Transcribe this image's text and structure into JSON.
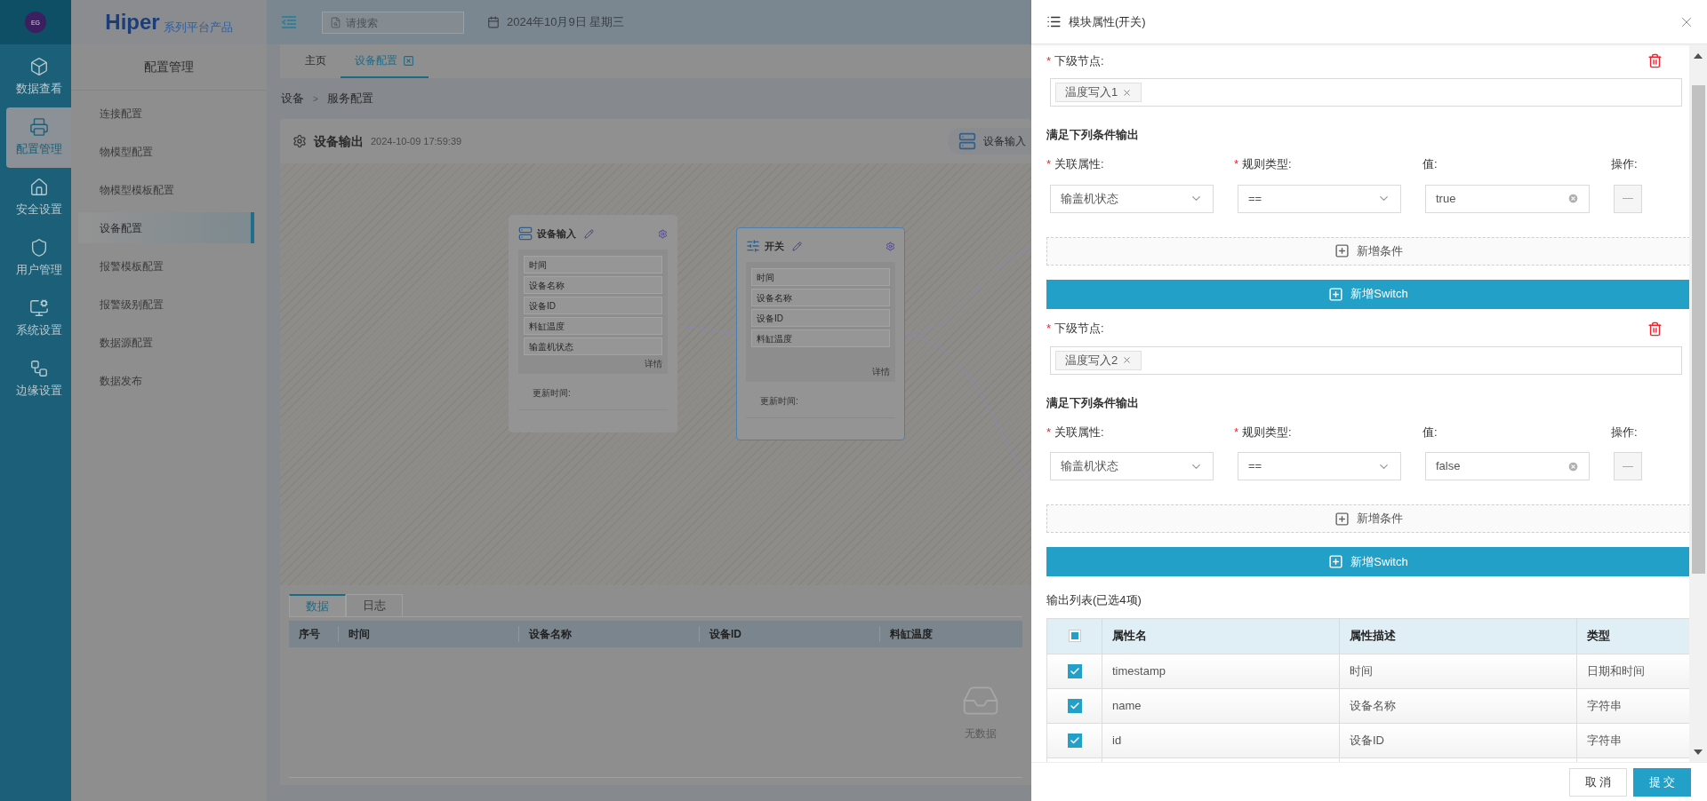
{
  "rail": {
    "logo_text": "EG",
    "items": [
      {
        "label": "数据查看",
        "kind": "cube",
        "selected": false
      },
      {
        "label": "配置管理",
        "kind": "printer",
        "selected": true
      },
      {
        "label": "安全设置",
        "kind": "house",
        "selected": false
      },
      {
        "label": "用户管理",
        "kind": "shield",
        "selected": false
      },
      {
        "label": "系统设置",
        "kind": "monitor",
        "selected": false
      },
      {
        "label": "边缘设置",
        "kind": "workflow",
        "selected": false
      }
    ]
  },
  "brand": {
    "name": "Hiper",
    "tagline": "系列平台产品"
  },
  "config_menu": {
    "title": "配置管理",
    "items": [
      {
        "label": "连接配置",
        "selected": false
      },
      {
        "label": "物模型配置",
        "selected": false
      },
      {
        "label": "物模型模板配置",
        "selected": false
      },
      {
        "label": "设备配置",
        "selected": true
      },
      {
        "label": "报警模板配置",
        "selected": false
      },
      {
        "label": "报警级别配置",
        "selected": false
      },
      {
        "label": "数据源配置",
        "selected": false
      },
      {
        "label": "数据发布",
        "selected": false
      }
    ]
  },
  "topbar": {
    "search": {
      "placeholder": "请搜索"
    },
    "date": "2024年10月9日 星期三"
  },
  "page_tabs": [
    {
      "label": "主页",
      "selected": false,
      "closable": false
    },
    {
      "label": "设备配置",
      "selected": true,
      "closable": true
    }
  ],
  "breadcrumb": {
    "items": [
      "设备",
      "服务配置"
    ],
    "separator": ">"
  },
  "module_header": {
    "title": "设备输出",
    "timestamp": "2024-10-09 17:59:39",
    "action": "设备输入"
  },
  "canvas": {
    "nodes": [
      {
        "kind": "input",
        "title": "设备输入",
        "selected": false,
        "fields": [
          "时间",
          "设备名称",
          "设备ID",
          "料缸温度",
          "输盖机状态"
        ],
        "detail": "详情",
        "updated_label": "更新时间:"
      },
      {
        "kind": "switch",
        "title": "开关",
        "selected": true,
        "fields": [
          "时间",
          "设备名称",
          "设备ID",
          "料缸温度"
        ],
        "detail": "详情",
        "updated_label": "更新时间:"
      }
    ]
  },
  "bottom_panel": {
    "tabs": [
      {
        "label": "数据",
        "selected": true
      },
      {
        "label": "日志",
        "selected": false
      }
    ],
    "columns": [
      "序号",
      "时间",
      "设备名称",
      "设备ID",
      "料缸温度"
    ],
    "empty_text": "无数据"
  },
  "drawer": {
    "title": "模块属性(开关)",
    "switches": [
      {
        "next_node_label": {
          "text": "下级节点:",
          "required_mark": "*"
        },
        "next_nodes": [
          "温度写入1"
        ],
        "condition_title": "满足下列条件输出",
        "condition_headers": [
          {
            "text": "关联属性:",
            "required_mark": "*"
          },
          {
            "text": "规则类型:",
            "required_mark": "*"
          },
          {
            "text": "值:"
          },
          {
            "text": "操作:"
          }
        ],
        "conditions": [
          {
            "attribute": "输盖机状态",
            "rule": "==",
            "value": "true"
          }
        ],
        "add_condition": "新增条件",
        "add_switch": "新增Switch"
      },
      {
        "next_node_label": {
          "text": "下级节点:",
          "required_mark": "*"
        },
        "next_nodes": [
          "温度写入2"
        ],
        "condition_title": "满足下列条件输出",
        "condition_headers": [
          {
            "text": "关联属性:",
            "required_mark": "*"
          },
          {
            "text": "规则类型:",
            "required_mark": "*"
          },
          {
            "text": "值:"
          },
          {
            "text": "操作:"
          }
        ],
        "conditions": [
          {
            "attribute": "输盖机状态",
            "rule": "==",
            "value": "false"
          }
        ],
        "add_condition": "新增条件",
        "add_switch": "新增Switch"
      }
    ],
    "output_title": "输出列表(已选4项)",
    "output_header_indeterminate": true,
    "output_columns": [
      "属性名",
      "属性描述",
      "类型"
    ],
    "output_rows": [
      {
        "name": "timestamp",
        "description": "时间",
        "type": "日期和时间",
        "checked": true
      },
      {
        "name": "name",
        "description": "设备名称",
        "type": "字符串",
        "checked": true
      },
      {
        "name": "id",
        "description": "设备ID",
        "type": "字符串",
        "checked": true
      }
    ],
    "buttons": [
      {
        "label": "取 消",
        "kind": "cancel"
      },
      {
        "label": "提 交",
        "kind": "submit"
      }
    ]
  }
}
